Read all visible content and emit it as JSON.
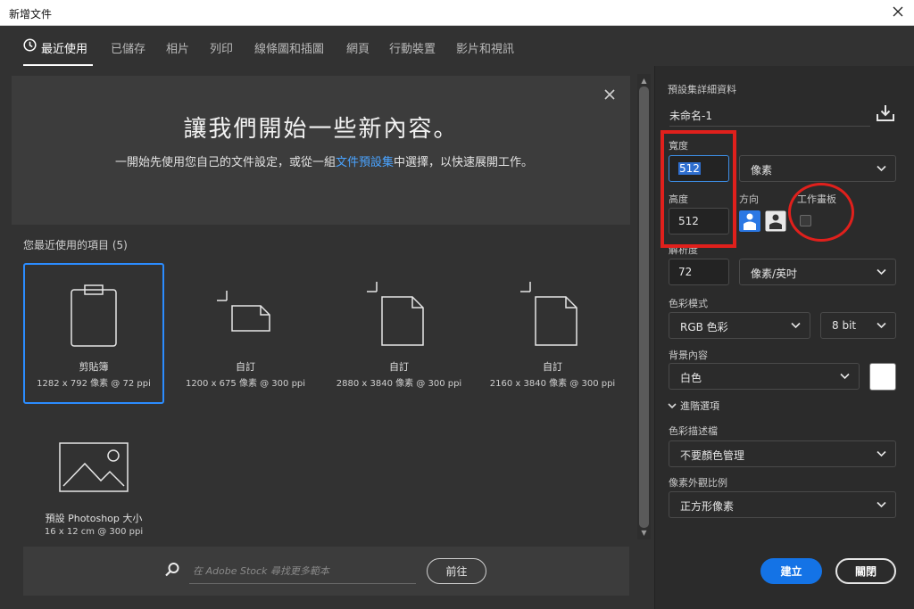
{
  "window": {
    "title": "新增文件"
  },
  "tabs": [
    {
      "label": "最近使用"
    },
    {
      "label": "已儲存"
    },
    {
      "label": "相片"
    },
    {
      "label": "列印"
    },
    {
      "label": "線條圖和插圖"
    },
    {
      "label": "網頁"
    },
    {
      "label": "行動裝置"
    },
    {
      "label": "影片和視訊"
    }
  ],
  "hero": {
    "heading": "讓我們開始一些新內容。",
    "desc_before": "一開始先使用您自己的文件設定，或從一組",
    "desc_link": "文件預設集",
    "desc_after": "中選擇，以快速展開工作。"
  },
  "recent": {
    "title": "您最近使用的項目 (5)",
    "items": [
      {
        "name": "剪貼簿",
        "size": "1282 x 792 像素 @ 72 ppi",
        "icon": "clipboard-icon"
      },
      {
        "name": "自訂",
        "size": "1200 x 675 像素 @ 300 ppi",
        "icon": "landscape-document-icon"
      },
      {
        "name": "自訂",
        "size": "2880 x 3840 像素 @ 300 ppi",
        "icon": "portrait-document-icon"
      },
      {
        "name": "自訂",
        "size": "2160 x 3840 像素 @ 300 ppi",
        "icon": "portrait-document-icon"
      },
      {
        "name": "預設 Photoshop 大小",
        "size": "16 x 12 cm @ 300 ppi",
        "icon": "image-icon"
      }
    ]
  },
  "search": {
    "placeholder": "在 Adobe Stock 尋找更多範本",
    "go_label": "前往"
  },
  "details": {
    "section_title": "預設集詳細資料",
    "doc_name": "未命名-1",
    "width_label": "寬度",
    "width_value": "512",
    "height_label": "高度",
    "height_value": "512",
    "unit": "像素",
    "orientation_label": "方向",
    "artboard_label": "工作畫板",
    "resolution_label": "解析度",
    "resolution_value": "72",
    "resolution_unit": "像素/英吋",
    "color_mode_label": "色彩模式",
    "color_mode": "RGB 色彩",
    "bit_depth": "8 bit",
    "background_label": "背景內容",
    "background": "白色",
    "background_color": "#ffffff",
    "advanced_label": "進階選項",
    "profile_label": "色彩描述檔",
    "profile": "不要顏色管理",
    "pixel_aspect_label": "像素外觀比例",
    "pixel_aspect": "正方形像素",
    "create_label": "建立",
    "close_label": "關閉"
  },
  "colors": {
    "accent": "#1473e6",
    "annotation": "#e0201c",
    "panel": "#323232"
  }
}
